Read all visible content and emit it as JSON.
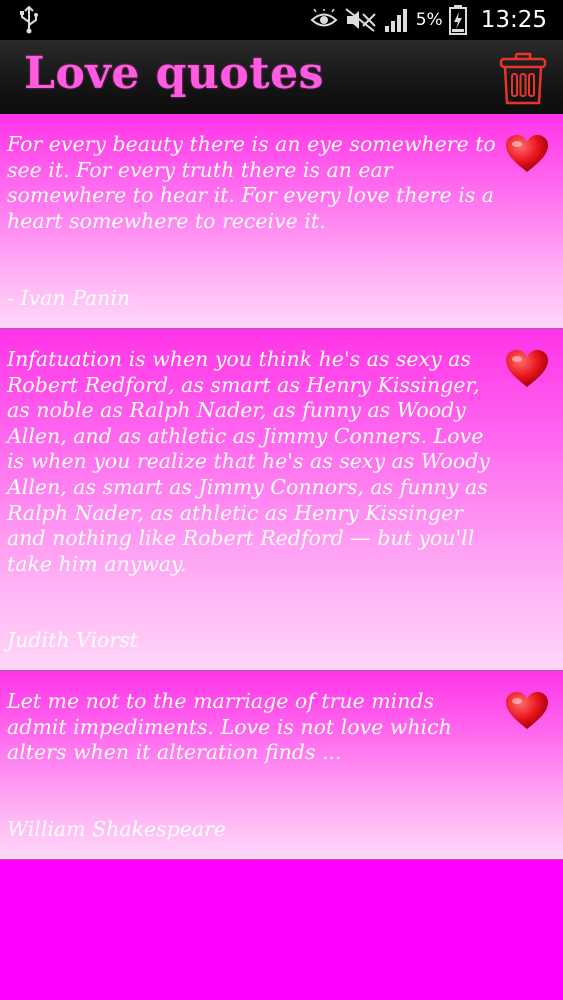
{
  "status_bar": {
    "battery_percent": "5%",
    "time": "13:25",
    "icons": [
      "usb-icon",
      "eye-icon",
      "mute-icon",
      "signal-icon",
      "battery-icon"
    ]
  },
  "app_bar": {
    "title": "Love quotes",
    "title_color": "#ff5ce1",
    "delete_icon": "trash-icon",
    "delete_icon_color": "#e8352b"
  },
  "quotes": [
    {
      "text": "For every beauty there is an eye somewhere to see it. For every truth there is an ear somewhere to hear it. For every love there is a heart somewhere to receive it.",
      "author": "- Ivan Panin",
      "favorite_icon": "heart-icon"
    },
    {
      "text": "Infatuation is when you think he's as sexy as Robert Redford, as smart as Henry Kissinger, as noble as Ralph Nader, as funny as Woody Allen, and as athletic as Jimmy Conners. Love is when you realize that he's as sexy as Woody Allen, as smart as Jimmy Connors, as funny as Ralph Nader, as athletic as Henry Kissinger and nothing like Robert Redford — but you'll take him anyway.",
      "author": "Judith Viorst",
      "favorite_icon": "heart-icon"
    },
    {
      "text": "Let me not to the marriage of true minds admit impediments. Love is not love which alters when it alteration finds ...",
      "author": "William Shakespeare",
      "favorite_icon": "heart-icon"
    }
  ],
  "colors": {
    "background": "#ff00ff",
    "heart": "#e8141e",
    "text": "#ffffff"
  }
}
